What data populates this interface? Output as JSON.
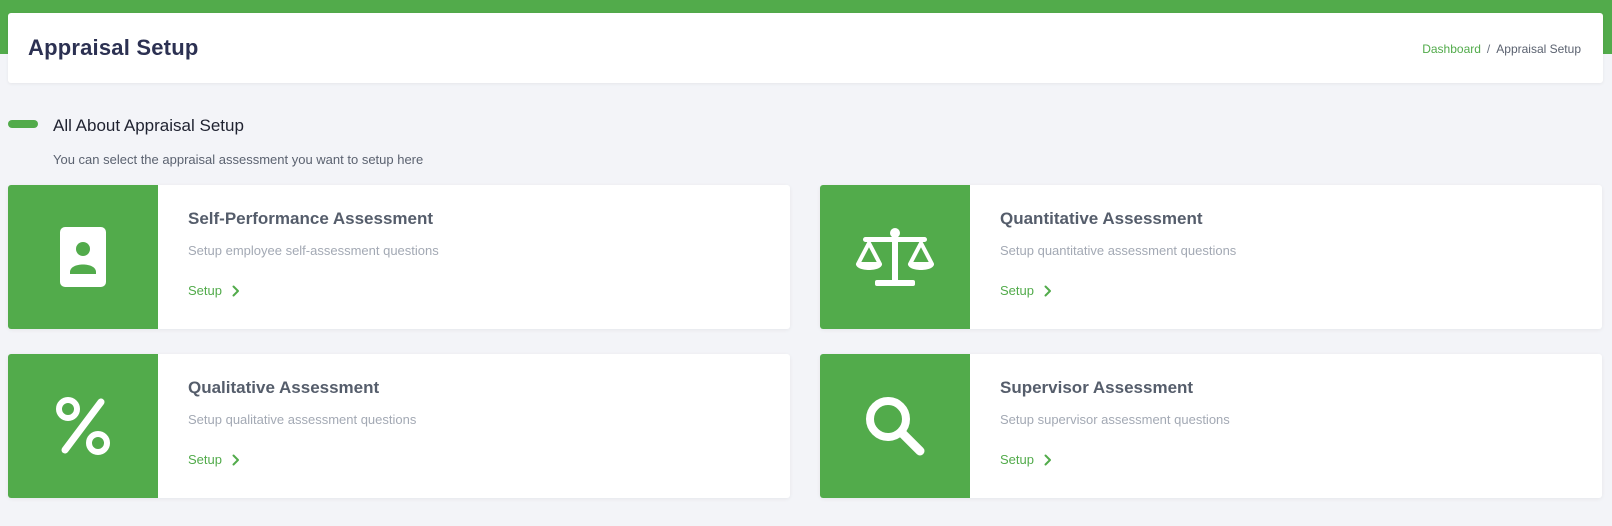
{
  "header": {
    "title": "Appraisal Setup",
    "breadcrumb": {
      "link": "Dashboard",
      "separator": "/",
      "current": "Appraisal Setup"
    }
  },
  "section": {
    "title": "All About Appraisal Setup",
    "subtitle": "You can select the appraisal assessment you want to setup here"
  },
  "cards": [
    {
      "title": "Self-Performance Assessment",
      "description": "Setup employee self-assessment questions",
      "link_label": "Setup",
      "icon": "id-badge-icon"
    },
    {
      "title": "Quantitative Assessment",
      "description": "Setup quantitative assessment questions",
      "link_label": "Setup",
      "icon": "balance-scale-icon"
    },
    {
      "title": "Qualitative Assessment",
      "description": "Setup qualitative assessment questions",
      "link_label": "Setup",
      "icon": "percent-icon"
    },
    {
      "title": "Supervisor Assessment",
      "description": "Setup supervisor assessment questions",
      "link_label": "Setup",
      "icon": "search-icon"
    }
  ],
  "colors": {
    "accent": "#52ab4b",
    "title_text": "#2c3152",
    "background": "#f3f4f8"
  }
}
